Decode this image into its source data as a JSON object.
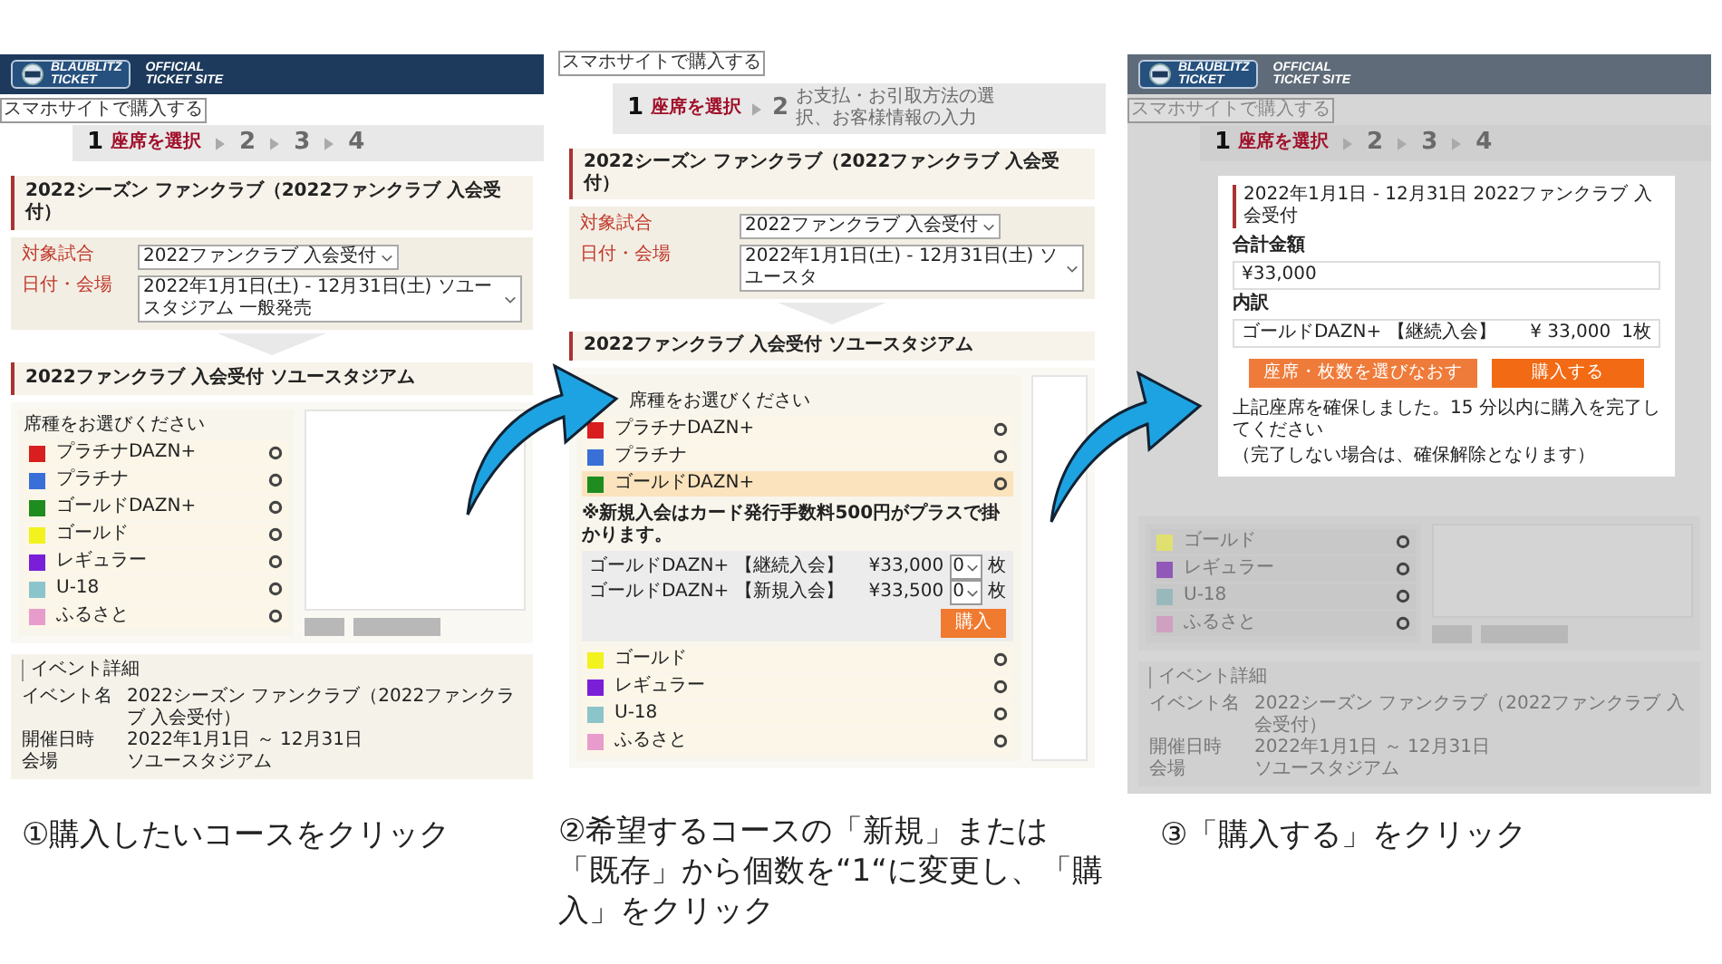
{
  "panels": [
    {
      "dimmed": false,
      "header": {
        "logo_lines": [
          "BLAUBLITZ",
          "TICKET"
        ],
        "site_lines": [
          "OFFICIAL",
          "TICKET SITE"
        ]
      },
      "smartphone_link": "スマホサイトで購入する",
      "steps": [
        {
          "number": "1",
          "label": "座席を選択",
          "selected": true
        },
        {
          "number": "2",
          "selected": false
        },
        {
          "number": "3",
          "selected": false
        },
        {
          "number": "4",
          "selected": false
        }
      ],
      "title": "2022シーズン ファンクラブ（2022ファンクラブ 入会受付）",
      "fields": [
        {
          "label": "対象試合",
          "value": "2022ファンクラブ 入会受付"
        },
        {
          "label": "日付・会場",
          "value": "2022年1月1日(土) - 12月31日(土) ソユースタジアム 一般発売"
        }
      ],
      "section_title": "2022ファンクラブ 入会受付 ソユースタジアム",
      "list_heading": "席種をお選びください",
      "seats": [
        {
          "name": "プラチナDAZN+",
          "color": "#d81e1e",
          "expanded": false
        },
        {
          "name": "プラチナ",
          "color": "#3a6fd8",
          "expanded": false
        },
        {
          "name": "ゴールドDAZN+",
          "color": "#1e8c1e",
          "expanded": false
        },
        {
          "name": "ゴールド",
          "color": "#f2f21e",
          "expanded": false
        },
        {
          "name": "レギュラー",
          "color": "#7a1ed8",
          "expanded": false
        },
        {
          "name": "U-18",
          "color": "#8cc4cc",
          "expanded": false
        },
        {
          "name": "ふるさと",
          "color": "#e89ccc",
          "expanded": false
        }
      ],
      "map_buttons": true,
      "event_details": {
        "title": "イベント詳細",
        "rows": [
          {
            "label": "イベント名",
            "value": "2022シーズン ファンクラブ（2022ファンクラブ 入会受付）"
          },
          {
            "label": "開催日時",
            "value": "2022年1月1日 ～ 12月31日"
          },
          {
            "label": "会場",
            "value": "ソユースタジアム"
          }
        ]
      }
    },
    {
      "dimmed": false,
      "smartphone_link": "スマホサイトで購入する",
      "steps": [
        {
          "number": "1",
          "label": "座席を選択",
          "selected": true
        },
        {
          "number": "2",
          "label": "お支払・お引取方法の選択、お客様情報の入力",
          "selected": false
        }
      ],
      "title": "2022シーズン ファンクラブ（2022ファンクラブ 入会受付）",
      "fields": [
        {
          "label": "対象試合",
          "value": "2022ファンクラブ 入会受付"
        },
        {
          "label": "日付・会場",
          "value": "2022年1月1日(土) - 12月31日(土) ソユースタ"
        }
      ],
      "section_title": "2022ファンクラブ 入会受付 ソユースタジアム",
      "list_heading": "席種をお選びください",
      "seats": [
        {
          "name": "プラチナDAZN+",
          "color": "#d81e1e",
          "expanded": false
        },
        {
          "name": "プラチナ",
          "color": "#3a6fd8",
          "expanded": false
        },
        {
          "name": "ゴールドDAZN+",
          "color": "#1e8c1e",
          "expanded": true,
          "note": "※新規入会はカード発行手数料500円がプラスで掛かります。",
          "options": [
            {
              "name": "ゴールドDAZN+ 【継続入会】",
              "price": "¥33,000",
              "quantity": "0",
              "unit": "枚"
            },
            {
              "name": "ゴールドDAZN+ 【新規入会】",
              "price": "¥33,500",
              "quantity": "0",
              "unit": "枚"
            }
          ],
          "buy_label": "購入"
        },
        {
          "name": "ゴールド",
          "color": "#f2f21e",
          "expanded": false
        },
        {
          "name": "レギュラー",
          "color": "#7a1ed8",
          "expanded": false
        },
        {
          "name": "U-18",
          "color": "#8cc4cc",
          "expanded": false
        },
        {
          "name": "ふるさと",
          "color": "#e89ccc",
          "expanded": false
        }
      ]
    },
    {
      "dimmed": true,
      "header": {
        "logo_lines": [
          "BLAUBLITZ",
          "TICKET"
        ],
        "site_lines": [
          "OFFICIAL",
          "TICKET SITE"
        ]
      },
      "smartphone_link": "スマホサイトで購入する",
      "steps": [
        {
          "number": "1",
          "label": "座席を選択",
          "selected": true
        },
        {
          "number": "2",
          "selected": false
        },
        {
          "number": "3",
          "selected": false
        },
        {
          "number": "4",
          "selected": false
        }
      ],
      "dialog": {
        "title": "2022年1月1日 - 12月31日 2022ファンクラブ 入会受付",
        "total_label": "合計金額",
        "total": "¥33,000",
        "breakdown_label": "内訳",
        "breakdown": {
          "name": "ゴールドDAZN+ 【継続入会】",
          "price": "¥ 33,000",
          "quantity": "1枚"
        },
        "buttons": [
          {
            "kind": "secondary",
            "label": "座席・枚数を選びなおす"
          },
          {
            "kind": "primary",
            "label": "購入する"
          }
        ],
        "message_lines": [
          "上記座席を確保しました。15 分以内に購入を完了してください",
          "（完了しない場合は、確保解除となります）"
        ]
      },
      "seats": [
        {
          "name": "ゴールド",
          "color": "#e0e070",
          "expanded": false
        },
        {
          "name": "レギュラー",
          "color": "#9058b8",
          "expanded": false
        },
        {
          "name": "U-18",
          "color": "#98b8bc",
          "expanded": false
        },
        {
          "name": "ふるさと",
          "color": "#d0a0c0",
          "expanded": false
        }
      ],
      "map_buttons": true,
      "event_details": {
        "title": "イベント詳細",
        "rows": [
          {
            "label": "イベント名",
            "value": "2022シーズン ファンクラブ（2022ファンクラブ 入会受付）"
          },
          {
            "label": "開催日時",
            "value": "2022年1月1日 ～ 12月31日"
          },
          {
            "label": "会場",
            "value": "ソユースタジアム"
          }
        ]
      }
    }
  ],
  "captions": [
    "①購入したいコースをクリック",
    "②希望するコースの「新規」または「既存」から個数を“1“に変更し、「購入」をクリック",
    "③「購入する」をクリック"
  ]
}
